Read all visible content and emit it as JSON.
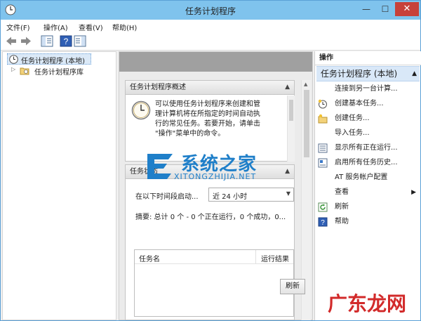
{
  "window": {
    "title": "任务计划程序"
  },
  "menu": [
    "文件(F)",
    "操作(A)",
    "查看(V)",
    "帮助(H)"
  ],
  "tree": {
    "root": "任务计划程序 (本地)",
    "child": "任务计划程序库"
  },
  "overview": {
    "header": "任务计划程序概述",
    "text_lines": [
      "可以使用任务计划程序来创建和管",
      "理计算机将在所指定的时间自动执",
      "行的常见任务。若要开始，请单击",
      "\"操作\"菜单中的命令。"
    ]
  },
  "status": {
    "header": "任务状态",
    "period_label": "在以下时间段启动...",
    "period_value": "近 24 小时",
    "summary": "摘要: 总计 0 个 - 0 个正在运行，0 个成功，0...",
    "columns": [
      "任务名",
      "运行结果"
    ]
  },
  "refresh_button": "刷新",
  "actions": {
    "header": "操作",
    "group": "任务计划程序 (本地)",
    "items": [
      {
        "label": "连接到另一台计算...",
        "icon": "blank"
      },
      {
        "label": "创建基本任务...",
        "icon": "clock-star-icon"
      },
      {
        "label": "创建任务...",
        "icon": "folder-star-icon"
      },
      {
        "label": "导入任务...",
        "icon": "blank"
      },
      {
        "label": "显示所有正在运行...",
        "icon": "list-icon"
      },
      {
        "label": "启用所有任务历史...",
        "icon": "history-icon"
      },
      {
        "label": "AT 服务帐户配置",
        "icon": "blank"
      },
      {
        "label": "查看",
        "icon": "blank",
        "submenu": true
      },
      {
        "label": "刷新",
        "icon": "refresh-icon"
      },
      {
        "label": "帮助",
        "icon": "help-icon"
      }
    ]
  },
  "watermarks": {
    "logo_text": "系统之家",
    "logo_url": "XITONGZHIJIA.NET",
    "corner_text": "广东龙网"
  },
  "colors": {
    "titlebar": "#7fc3ed",
    "close": "#c7413a",
    "selection": "#d9e8f8",
    "watermark_blue": "#1f7fc9",
    "watermark_red": "#d22a2a"
  }
}
